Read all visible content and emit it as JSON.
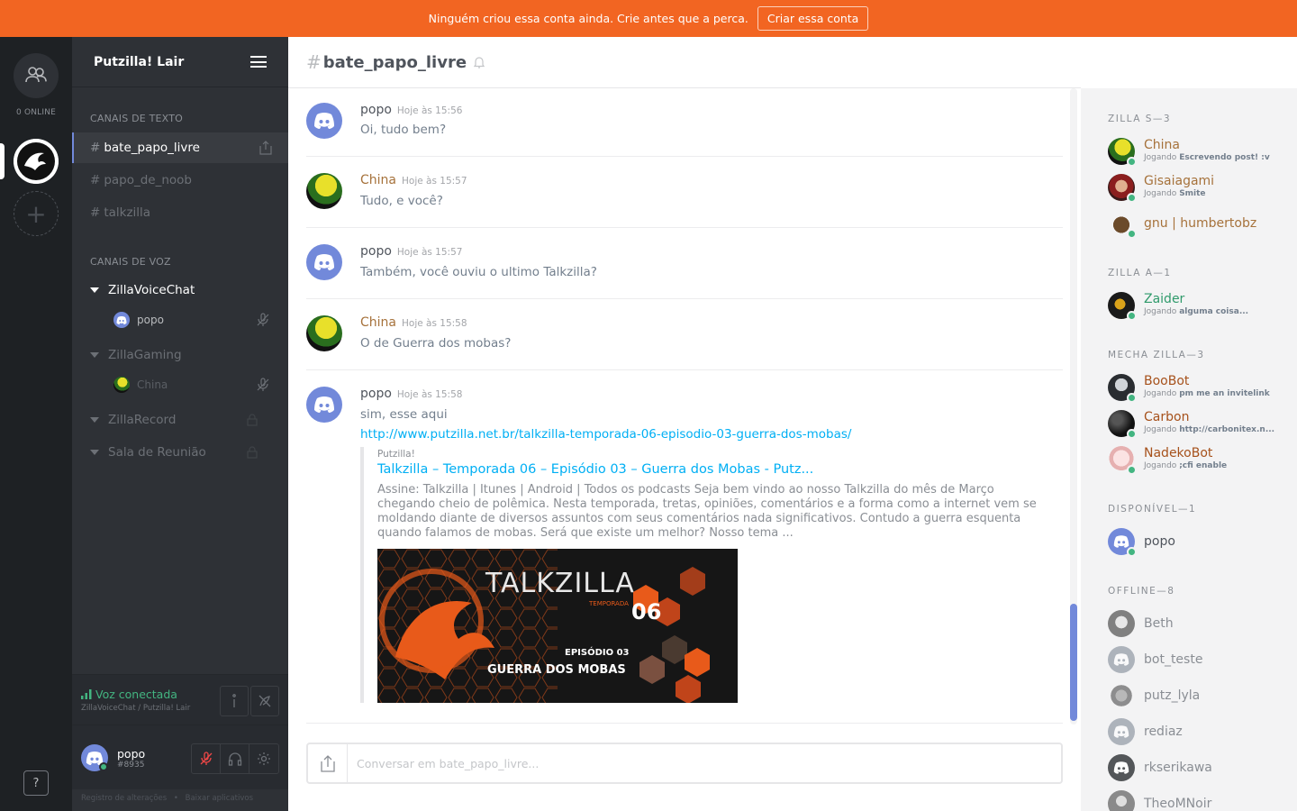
{
  "banner": {
    "text": "Ninguém criou essa conta ainda. Crie antes que a perca.",
    "cta": "Criar essa conta"
  },
  "guilds": {
    "online_count": "0 ONLINE",
    "help_label": "?"
  },
  "server": {
    "name": "Putzilla! Lair"
  },
  "text_channels": {
    "category": "CANAIS DE TEXTO",
    "items": [
      {
        "hash": "#",
        "name": "bate_papo_livre",
        "active": true
      },
      {
        "hash": "#",
        "name": "papo_de_noob"
      },
      {
        "hash": "#",
        "name": "talkzilla"
      }
    ]
  },
  "voice_channels": {
    "category": "CANAIS DE VOZ",
    "items": [
      {
        "name": "ZillaVoiceChat",
        "users": [
          "popo"
        ]
      },
      {
        "name": "ZillaGaming",
        "users": [
          "China"
        ]
      },
      {
        "name": "ZillaRecord"
      },
      {
        "name": "Sala de Reunião"
      }
    ]
  },
  "voice_status": {
    "title": "Voz conectada",
    "subtitle": "ZillaVoiceChat / Putzilla! Lair"
  },
  "user": {
    "name": "popo",
    "discriminator": "#8935"
  },
  "footer": {
    "changelog": "Registro de alterações",
    "separator": "•",
    "download": "Baixar aplicativos"
  },
  "chat": {
    "hash": "#",
    "channel": "bate_papo_livre",
    "placeholder": "Conversar em bate_papo_livre...",
    "messages": [
      {
        "author": "popo",
        "time": "Hoje às 15:56",
        "text": "Oi, tudo bem?"
      },
      {
        "author": "China",
        "time": "Hoje às 15:57",
        "text": "Tudo, e você?"
      },
      {
        "author": "popo",
        "time": "Hoje às 15:57",
        "text": "Também, você ouviu o ultimo Talkzilla?"
      },
      {
        "author": "China",
        "time": "Hoje às 15:58",
        "text": "O de Guerra dos mobas?"
      },
      {
        "author": "popo",
        "time": "Hoje às 15:58",
        "text": "sim, esse aqui",
        "link": "http://www.putzilla.net.br/talkzilla-temporada-06-episodio-03-guerra-dos-mobas/"
      }
    ],
    "embed": {
      "provider": "Putzilla!",
      "title": "Talkzilla – Temporada 06 – Episódio 03 – Guerra dos Mobas - Putz...",
      "description": "Assine: Talkzilla | Itunes | Android | Todos os podcasts Seja bem vindo ao nosso Talkzilla do mês de Março chegando cheio de polêmica. Nesta temporada, tretas, opiniões, comentários e a forma como a internet vem se moldando diante de diversos assuntos com seus comentários nada significativos. Contudo a guerra esquenta quando falamos de mobas. Será que existe um melhor? Nosso tema ...",
      "image": {
        "logo": "TALKZILLA",
        "season_label": "TEMPORADA",
        "season": "06",
        "episode": "EPISÓDIO 03",
        "subtitle": "GUERRA DOS MOBAS"
      }
    }
  },
  "members": {
    "groups": [
      {
        "label": "ZILLA S—3",
        "members": [
          {
            "name": "China",
            "playing": "Jogando",
            "game": "Escrevendo post! :v"
          },
          {
            "name": "Gisaiagami",
            "playing": "Jogando",
            "game": "Smite"
          },
          {
            "name": "gnu | humbertobz"
          }
        ]
      },
      {
        "label": "ZILLA A—1",
        "members": [
          {
            "name": "Zaider",
            "playing": "Jogando",
            "game": "alguma coisa..."
          }
        ]
      },
      {
        "label": "MECHA ZILLA—3",
        "members": [
          {
            "name": "BooBot",
            "playing": "Jogando",
            "game": "pm me an invitelink"
          },
          {
            "name": "Carbon",
            "playing": "Jogando",
            "game": "http://carbonitex.n..."
          },
          {
            "name": "NadekoBot",
            "playing": "Jogando",
            "game": ";cfi enable"
          }
        ]
      },
      {
        "label": "DISPONÍVEL—1",
        "members": [
          {
            "name": "popo"
          }
        ]
      },
      {
        "label": "OFFLINE—8",
        "members": [
          {
            "name": "Beth"
          },
          {
            "name": "bot_teste"
          },
          {
            "name": "putz_lyla"
          },
          {
            "name": "rediaz"
          },
          {
            "name": "rkserikawa"
          },
          {
            "name": "TheoMNoir"
          }
        ]
      }
    ]
  },
  "colors": {
    "accent": "#7289da",
    "banner": "#f26522",
    "online": "#43b581",
    "link": "#00aff4",
    "role": "#a6723b"
  }
}
